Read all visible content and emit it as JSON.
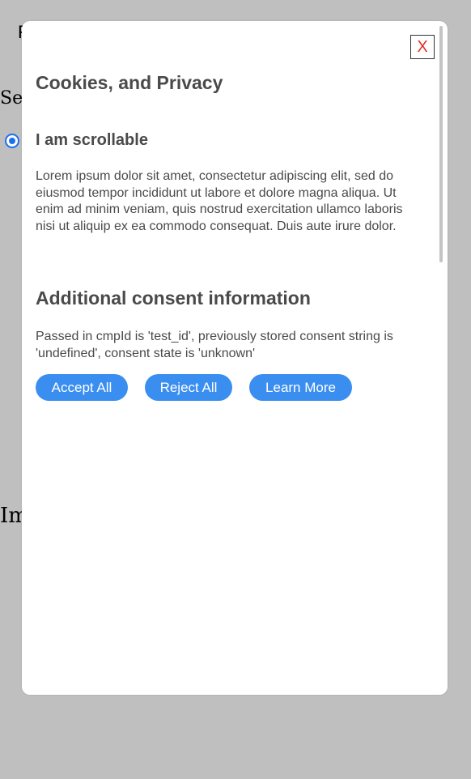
{
  "background": {
    "top_letter": "F",
    "sets_text": "Set",
    "im_text": "Im"
  },
  "modal": {
    "close_label": "X",
    "title": "Cookies, and Privacy",
    "section_heading": "I am scrollable",
    "lorem_text": "Lorem ipsum dolor sit amet, consectetur adipiscing elit, sed do eiusmod tempor incididunt ut labore et dolore magna aliqua. Ut enim ad minim veniam, quis nostrud exercitation ullamco laboris nisi ut aliquip ex ea commodo consequat. Duis aute irure dolor.",
    "consent_heading": "Additional consent information",
    "consent_text": "Passed in cmpId is 'test_id', previously stored consent string is 'undefined', consent state is 'unknown'",
    "buttons": {
      "accept": "Accept All",
      "reject": "Reject All",
      "learn_more": "Learn More"
    }
  },
  "colors": {
    "button_blue": "#3a8ef0",
    "close_x_red": "#e0302a",
    "backdrop_gray": "#bfbfbf",
    "radio_blue": "#1d6ff2"
  }
}
